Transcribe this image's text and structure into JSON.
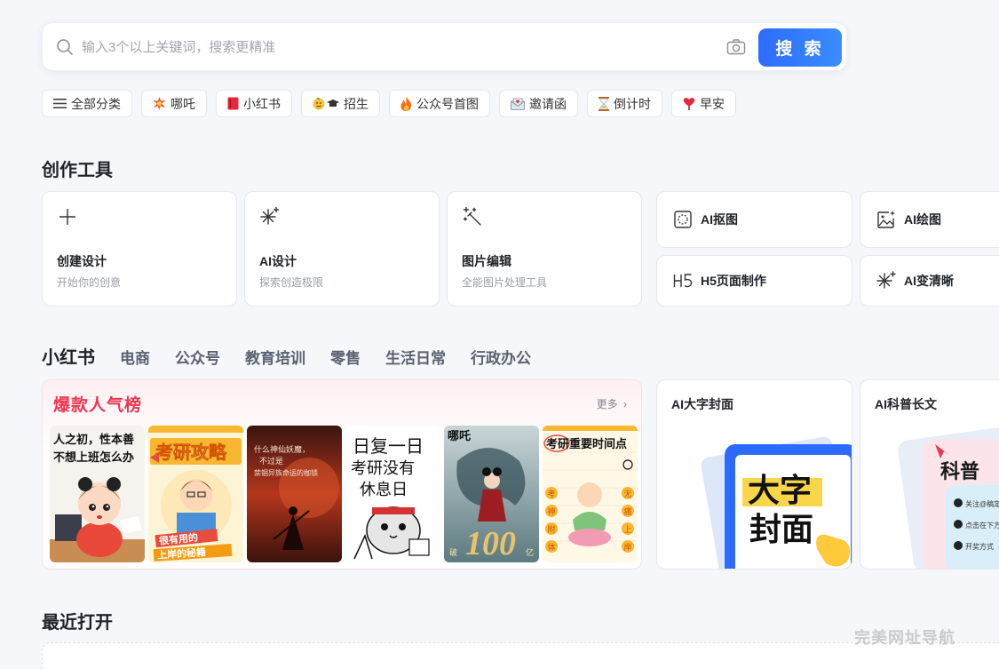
{
  "search": {
    "placeholder": "输入3个以上关键词，搜索更精准",
    "button_label": "搜 索"
  },
  "tags": [
    {
      "label": "全部分类",
      "icon": "menu-icon"
    },
    {
      "label": "哪吒",
      "icon": "burst-emoji-icon"
    },
    {
      "label": "小红书",
      "icon": "red-book-icon"
    },
    {
      "label": "招生",
      "icon": "student-graduation-icon"
    },
    {
      "label": "公众号首图",
      "icon": "fire-icon"
    },
    {
      "label": "邀请函",
      "icon": "envelope-icon"
    },
    {
      "label": "倒计时",
      "icon": "hourglass-icon"
    },
    {
      "label": "早安",
      "icon": "heart-icon"
    }
  ],
  "tools": {
    "title": "创作工具",
    "cards": [
      {
        "name": "创建设计",
        "desc": "开始你的创意",
        "icon": "plus-icon"
      },
      {
        "name": "AI设计",
        "desc": "探索创造极限",
        "icon": "sparkle-icon"
      },
      {
        "name": "图片编辑",
        "desc": "全能图片处理工具",
        "icon": "magic-wand-icon"
      }
    ],
    "mini": [
      {
        "name": "AI抠图",
        "icon": "cutout-icon"
      },
      {
        "name": "AI绘图",
        "icon": "image-sparkle-icon"
      },
      {
        "name": "H5页面制作",
        "icon": "h5-icon"
      },
      {
        "name": "AI变清晰",
        "icon": "sparkle-icon"
      }
    ]
  },
  "categories": [
    "小红书",
    "电商",
    "公众号",
    "教育培训",
    "零售",
    "生活日常",
    "行政办公"
  ],
  "trending": {
    "title": "爆款人气榜",
    "more": "更多",
    "thumbs": [
      {
        "line1": "人之初，性本善",
        "line2": "不想上班怎么办"
      },
      {
        "line1": "考研攻略",
        "line2": "很有用的",
        "line3": "上岸的秘籍"
      },
      {
        "line1": "什么神仙妖魔，",
        "line2": "不过是",
        "line3": "禁锢异族命运的枷锁"
      },
      {
        "line1": "日复一日",
        "line2": "考研没有",
        "line3": "休息日"
      },
      {
        "line1": "哪吒",
        "line2": "100",
        "line3": "破",
        "line4": "亿"
      },
      {
        "line1": "考研重要时间点",
        "line2": "考",
        "line3": "神",
        "line4": "附",
        "line5": "体",
        "line6": "无",
        "line7": "痛",
        "line8": "上",
        "line9": "岸"
      }
    ]
  },
  "ai_cards": [
    {
      "title": "AI大字封面",
      "art_line1": "大字",
      "art_line2": "封面"
    },
    {
      "title": "AI科普长文",
      "art_line1": "科普",
      "art_steps": [
        "关注@稿定",
        "点击在下方",
        "开奖方式"
      ]
    }
  ],
  "recent": {
    "title": "最近打开"
  },
  "watermark": "完美网址导航",
  "colors": {
    "primary": "#2d6bff",
    "hot": "#f0364f"
  }
}
